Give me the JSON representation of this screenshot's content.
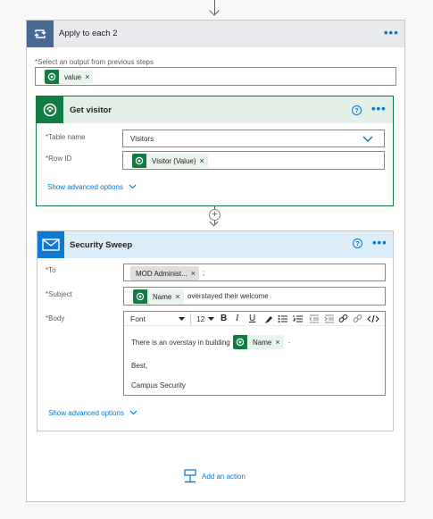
{
  "apply_each": {
    "title": "Apply to each 2",
    "select_label": "Select an output from previous steps",
    "token": "value"
  },
  "get_visitor": {
    "title": "Get visitor",
    "table_label": "Table name",
    "table_value": "Visitors",
    "rowid_label": "Row ID",
    "rowid_token": "Visitor (Value)",
    "advanced": "Show advanced options"
  },
  "security": {
    "title": "Security Sweep",
    "to_label": "To",
    "to_token": "MOD Administ...",
    "to_sep": ";",
    "subject_label": "Subject",
    "subject_token": "Name",
    "subject_text": "overstayed their welcome",
    "body_label": "Body",
    "font": "Font",
    "font_size": "12",
    "body_line1": "There is an overstay in building",
    "body_token": "Name",
    "body_line1_end": ".",
    "body_line2": "Best,",
    "body_line3": "Campus Security",
    "advanced": "Show advanced options"
  },
  "add_action": "Add an action",
  "required_mark": "*",
  "token_remove": "×",
  "help_glyph": "?",
  "more_glyph": "•••",
  "colors": {
    "loop_header": "#486991",
    "dataverse": "#107c41",
    "outlook": "#0f78d4",
    "link": "#0078d4"
  }
}
